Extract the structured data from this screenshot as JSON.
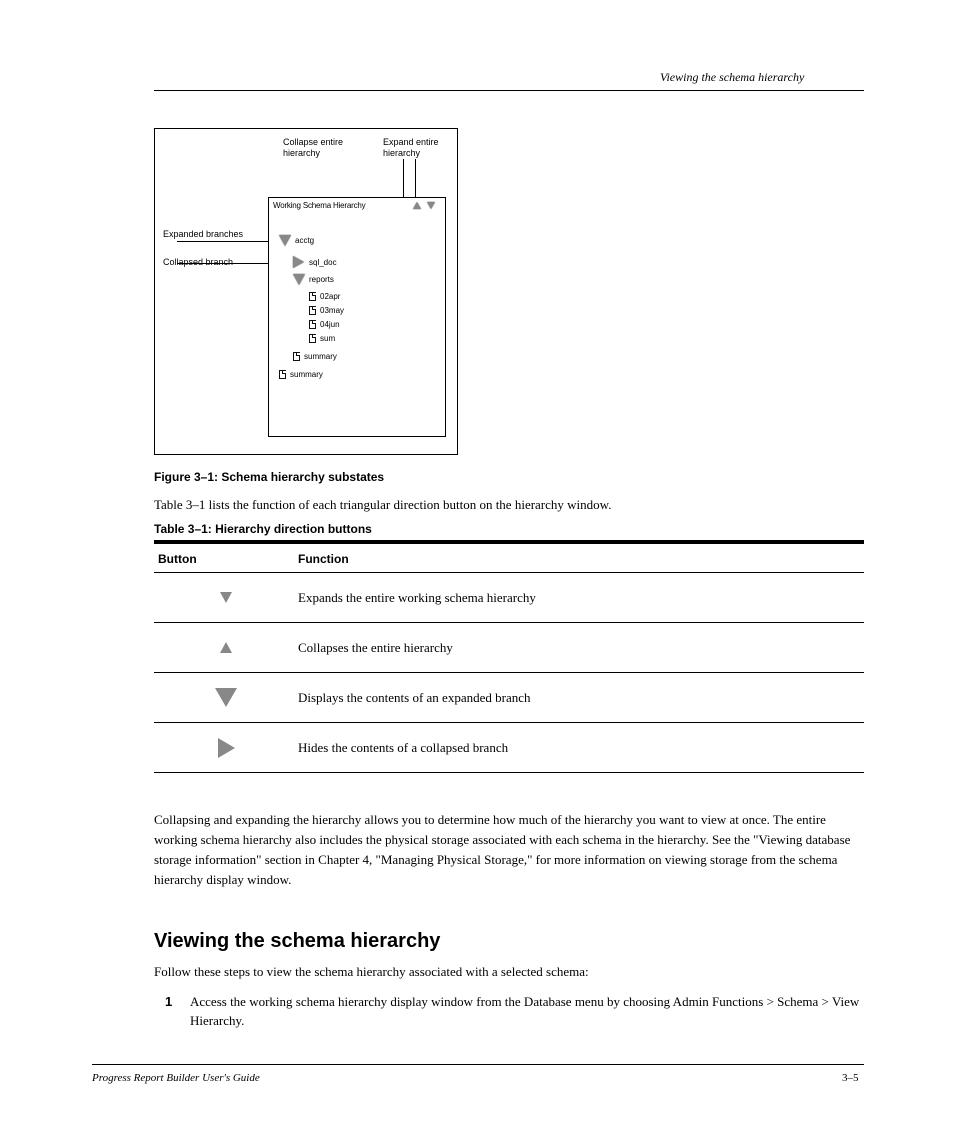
{
  "header_text": "Viewing the schema hierarchy",
  "diagram": {
    "panel_title": "Working Schema Hierarchy",
    "tree": {
      "root": "acctg",
      "branch1": "sql_doc",
      "branch1_child": "reports",
      "files": [
        "02apr",
        "03may",
        "04jun",
        "sum"
      ],
      "root_file": "summary"
    },
    "callouts": {
      "collapse": "Collapse entire hierarchy",
      "expand": "Expand entire hierarchy",
      "expanded": "Expanded branches",
      "collapsed": "Collapsed branch"
    },
    "caption": "Figure 3–1: Schema hierarchy substates"
  },
  "intro_text": "Table 3–1 lists the function of each triangular direction button on the hierarchy window.",
  "table": {
    "caption": "Table 3–1: Hierarchy direction buttons",
    "col1": "Button",
    "col2": "Function",
    "rows": [
      {
        "desc": "Expands the entire working schema hierarchy"
      },
      {
        "desc": "Collapses the entire hierarchy"
      },
      {
        "desc": "Displays the contents of an expanded branch"
      },
      {
        "desc": "Hides the contents of a collapsed branch"
      }
    ]
  },
  "explain_para": "Collapsing and expanding the hierarchy allows you to determine how much of the hierarchy you want to view at once. The entire working schema hierarchy also includes the physical storage associated with each schema in the hierarchy. See the \"Viewing database storage information\" section in Chapter 4, \"Managing Physical Storage,\" for more information on viewing storage from the schema hierarchy display window.",
  "heading_text": "Viewing the schema hierarchy",
  "heading_body": "Follow these steps to view the schema hierarchy associated with a selected schema:",
  "step_num": "1",
  "step_text": "Access the working schema hierarchy display window from the Database menu by choosing Admin Functions > Schema > View Hierarchy.",
  "footer_manual": "Progress Report Builder User's Guide",
  "footer_page": "3–5"
}
